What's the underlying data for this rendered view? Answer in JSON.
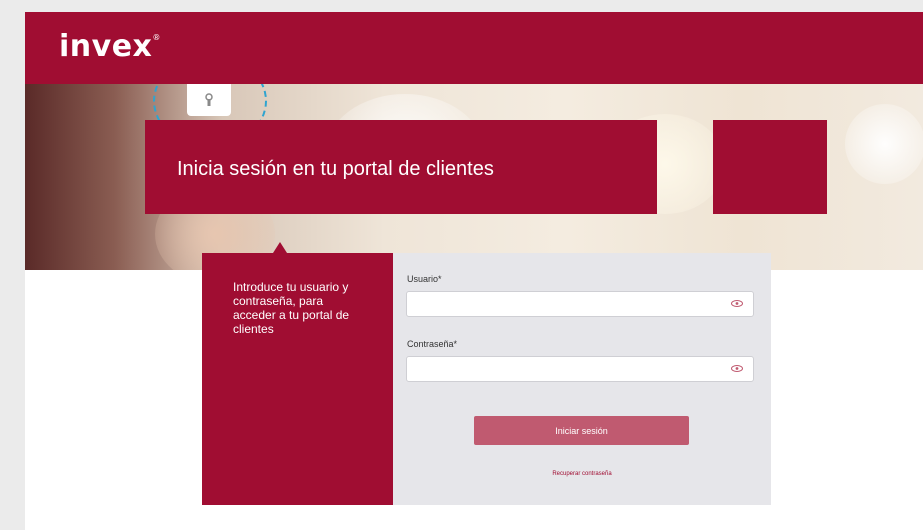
{
  "header": {
    "logo_text": "invex",
    "logo_mark": "®"
  },
  "hero": {
    "title": "Inicia sesión en tu portal de clientes"
  },
  "intro": {
    "text": "Introduce tu usuario y contraseña, para acceder a tu portal de clientes"
  },
  "form": {
    "username_label": "Usuario*",
    "username_value": "",
    "password_label": "Contraseña*",
    "password_value": "",
    "submit_label": "Iniciar sesión",
    "recover_label": "Recuperar contraseña"
  },
  "icons": {
    "eye": "eye-icon",
    "lock": "lock-icon"
  },
  "colors": {
    "brand": "#a00d32",
    "button": "#c05a70",
    "form_bg": "#e6e6ea"
  }
}
